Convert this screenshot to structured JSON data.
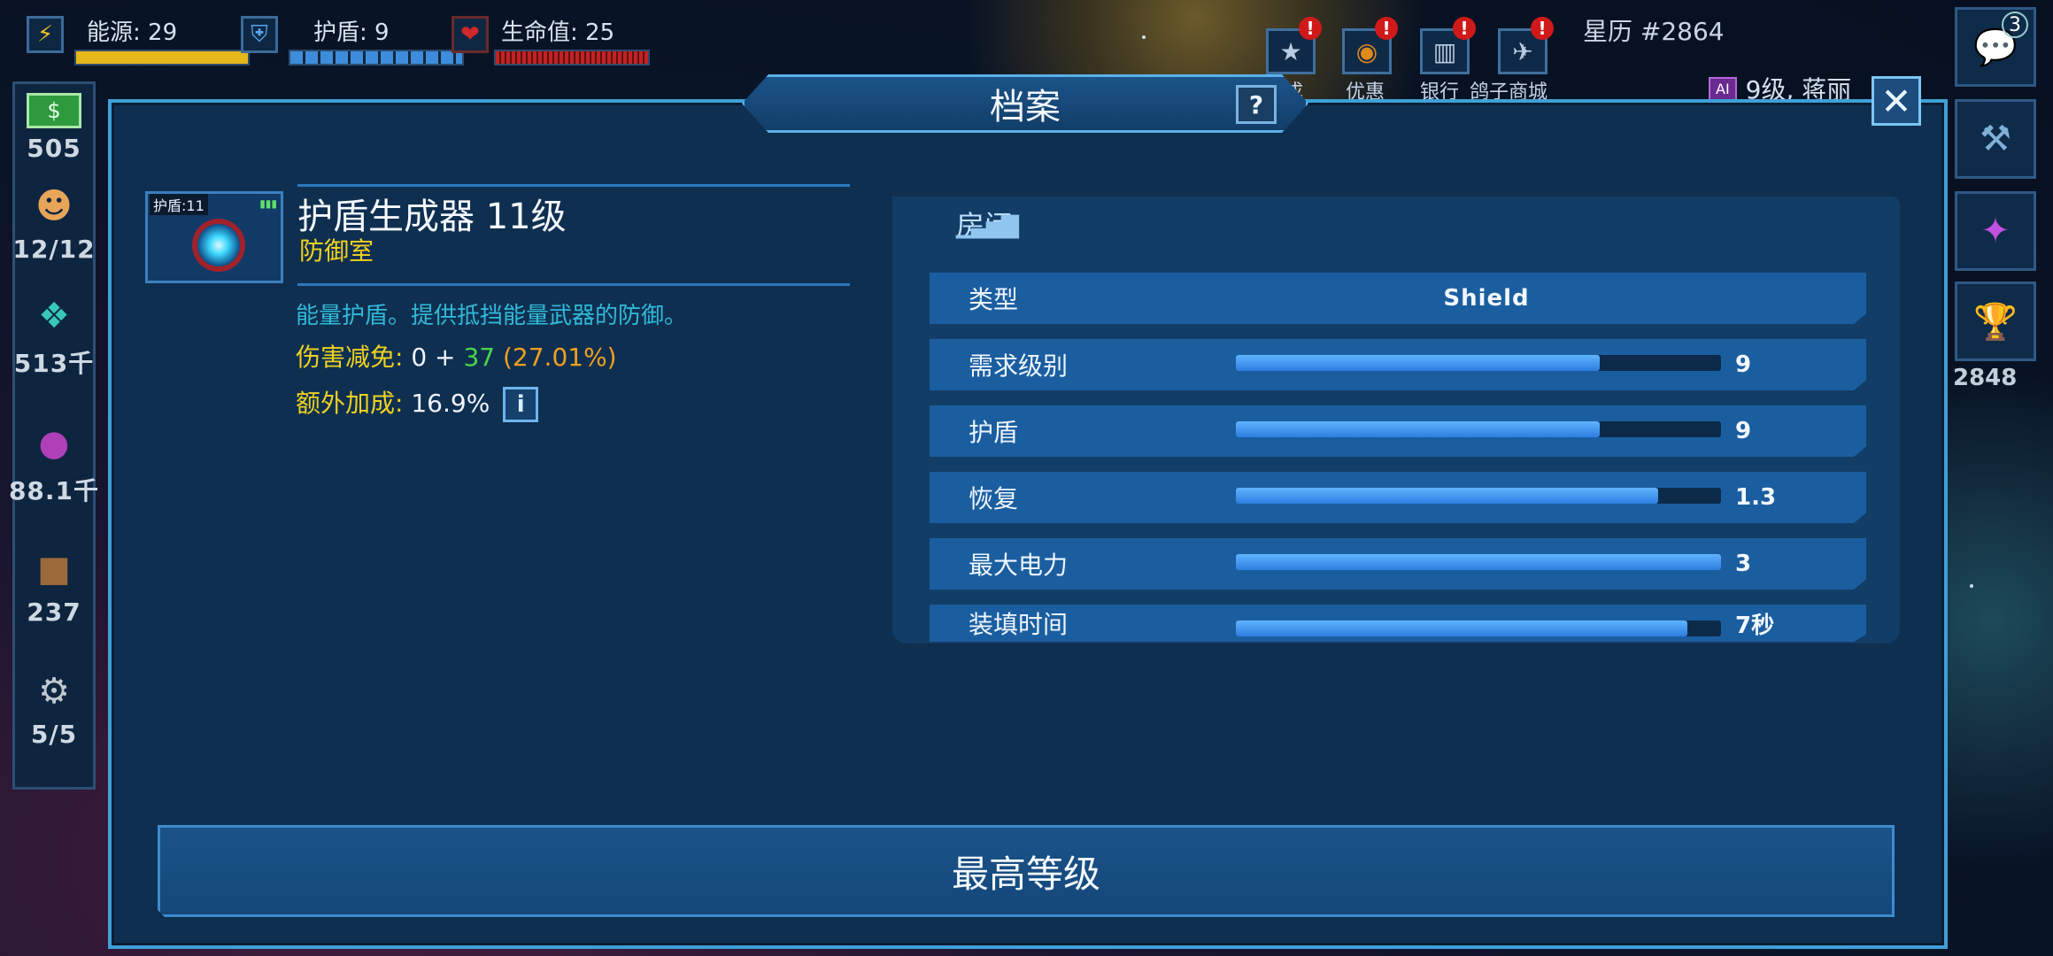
{
  "hud": {
    "energy": {
      "label": "能源: 29",
      "fill_percent": 100,
      "color": "#e6b71b"
    },
    "shield": {
      "label": "护盾: 9",
      "fill_percent": 100,
      "color": "#3d8ddc"
    },
    "hull": {
      "label": "生命值: 25",
      "fill_percent": 100,
      "color": "#c42222"
    },
    "stardate": "星历 #2864",
    "top_buttons": [
      {
        "label": "成",
        "icon": "star-badge-icon",
        "alert": "!"
      },
      {
        "label": "优惠",
        "icon": "pumpkin-icon",
        "alert": "!"
      },
      {
        "label": "银行",
        "icon": "bank-icon",
        "alert": "!"
      },
      {
        "label": "鸽子商城",
        "icon": "pigeon-icon",
        "alert": "!"
      }
    ],
    "player": {
      "ai_badge": "AI",
      "text": "9级, 蒋丽"
    }
  },
  "left_sidebar": [
    {
      "icon": "cash-icon",
      "value": "505"
    },
    {
      "icon": "crew-icon",
      "value": "12/12"
    },
    {
      "icon": "crystal-icon",
      "value": "513千"
    },
    {
      "icon": "planet-orb-icon",
      "value": "88.1千"
    },
    {
      "icon": "crate-icon",
      "value": "237"
    },
    {
      "icon": "ship-gear-icon",
      "value": "5/5"
    }
  ],
  "right_sidebar": {
    "items": [
      {
        "icon": "chat-icon",
        "badge": "3"
      },
      {
        "icon": "hammer-icon"
      },
      {
        "icon": "alliance-icon"
      },
      {
        "icon": "trophy-icon"
      }
    ],
    "trophy_value": "2848"
  },
  "modal": {
    "title": "档案",
    "help_label": "?",
    "close_label": "✕",
    "item": {
      "thumb_tag": "护盾:11",
      "name": "护盾生成器 11级",
      "category": "防御室",
      "description": "能量护盾。提供抵挡能量武器的防御。",
      "damage_reduction_label": "伤害减免:",
      "damage_reduction_base": "0 +",
      "damage_reduction_bonus": "37",
      "damage_reduction_pct": "(27.01%)",
      "extra_bonus_label": "额外加成:",
      "extra_bonus_value": "16.9%",
      "info_label": "i"
    },
    "room": {
      "tab_label": "房间",
      "type_row": {
        "label": "类型",
        "value": "Shield"
      },
      "stats": [
        {
          "label": "需求级别",
          "value": "9",
          "fill": 0.75
        },
        {
          "label": "护盾",
          "value": "9",
          "fill": 0.75
        },
        {
          "label": "恢复",
          "value": "1.3",
          "fill": 0.87
        },
        {
          "label": "最大电力",
          "value": "3",
          "fill": 1.0
        },
        {
          "label": "装填时间",
          "value": "7秒",
          "fill": 0.93
        }
      ]
    },
    "max_level_button": "最高等级"
  }
}
